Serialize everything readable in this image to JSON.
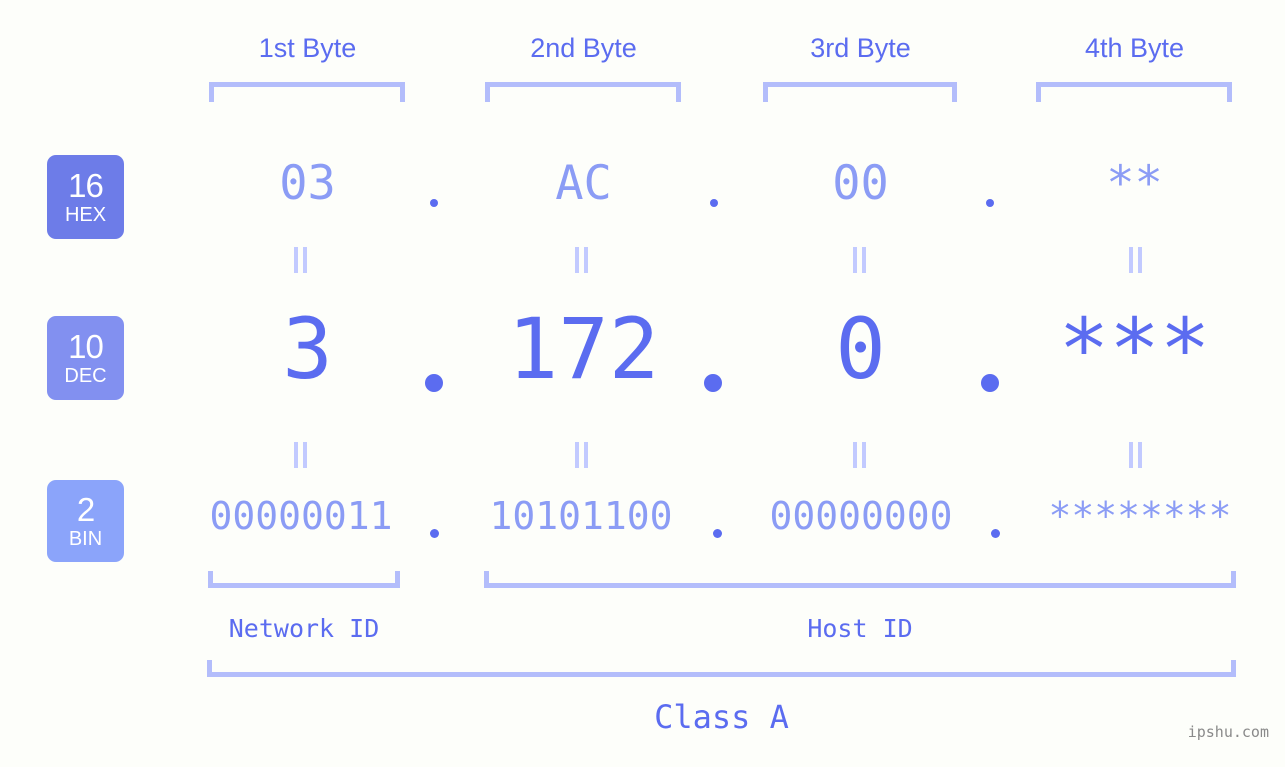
{
  "watermark": "ipshu.com",
  "byte_headers": [
    {
      "label": "1st Byte"
    },
    {
      "label": "2nd Byte"
    },
    {
      "label": "3rd Byte"
    },
    {
      "label": "4th Byte"
    }
  ],
  "rows": [
    {
      "badge_number": "16",
      "badge_label": "HEX",
      "badge_color": "#6d7ce8",
      "values": [
        "03",
        "AC",
        "00",
        "**"
      ],
      "separator": "."
    },
    {
      "badge_number": "10",
      "badge_label": "DEC",
      "badge_color": "#8290f0",
      "values": [
        "3",
        "172",
        "0",
        "***"
      ],
      "separator": "."
    },
    {
      "badge_number": "2",
      "badge_label": "BIN",
      "badge_color": "#8ba4fa",
      "values": [
        "00000011",
        "10101100",
        "00000000",
        "********"
      ],
      "separator": "."
    }
  ],
  "id_sections": [
    {
      "label": "Network ID"
    },
    {
      "label": "Host ID"
    }
  ],
  "class": {
    "label": "Class A"
  },
  "colors": {
    "background": "#fdfefa",
    "accent": "#5b6cf0",
    "accent_light": "#8b9cf5",
    "bracket": "#b3bdfb",
    "equals": "#c2caff",
    "watermark": "#8a8a8a"
  }
}
